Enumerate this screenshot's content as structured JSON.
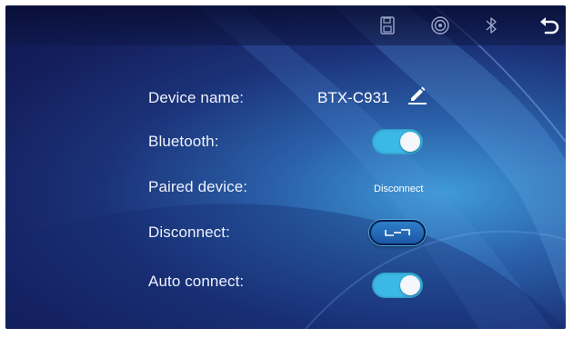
{
  "topbar": {
    "icons": [
      "save-icon",
      "cast-icon",
      "bluetooth-icon",
      "back-arrow-icon"
    ]
  },
  "settings": {
    "device_name": {
      "label": "Device name:",
      "value": "BTX-C931"
    },
    "bluetooth": {
      "label": "Bluetooth:",
      "enabled": true
    },
    "paired_device": {
      "label": "Paired device:",
      "status": "Disconnect"
    },
    "disconnect": {
      "label": "Disconnect:"
    },
    "auto_connect": {
      "label": "Auto connect:",
      "enabled": true
    }
  },
  "colors": {
    "toggle_on": "#3cb8e6",
    "background_dark": "#141e5c",
    "background_light": "#3f9bd6",
    "text": "#eef2fb"
  }
}
